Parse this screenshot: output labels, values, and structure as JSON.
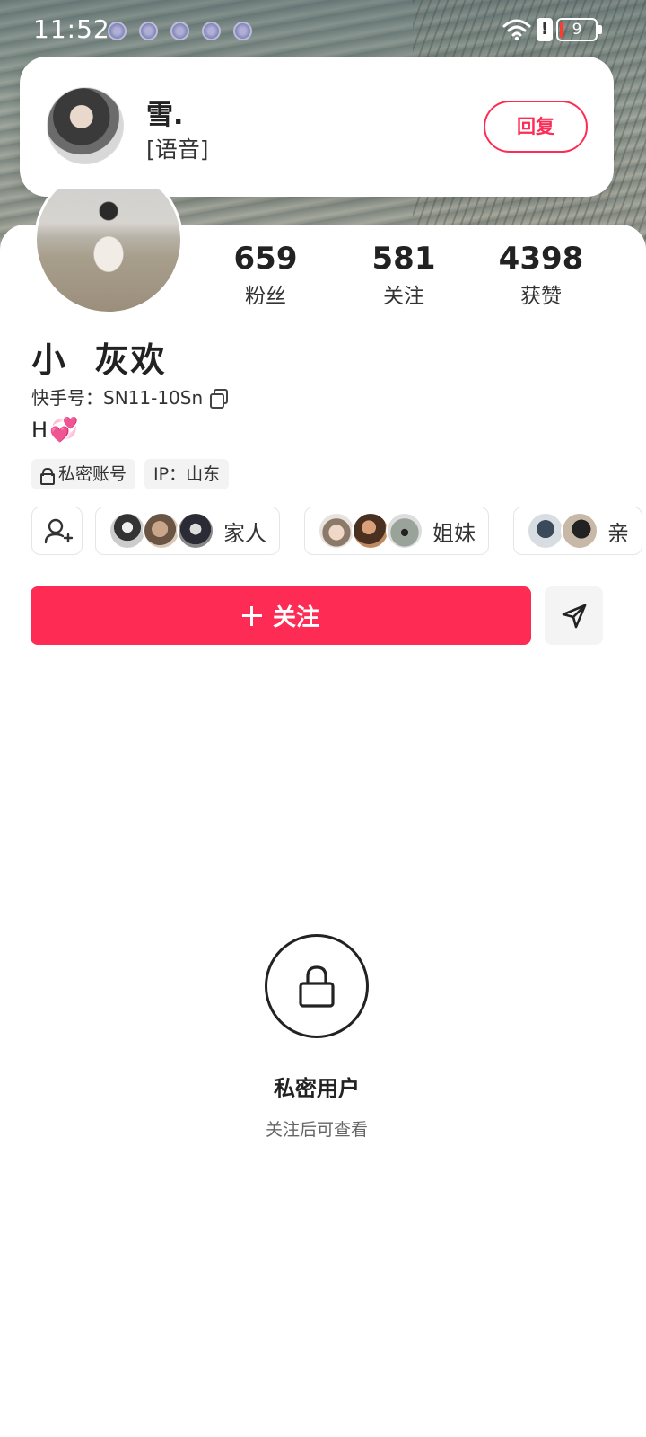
{
  "status_bar": {
    "time": "11:52",
    "battery": "9",
    "notification_icons": [
      "app-notification-icon",
      "app-notification-icon",
      "app-notification-icon",
      "app-notification-icon",
      "app-notification-icon"
    ],
    "indicators": [
      "wifi-icon",
      "alert-icon",
      "battery-icon"
    ],
    "alert_glyph": "!"
  },
  "notification": {
    "sender": "雪.",
    "message": "[语音]",
    "reply_label": "回复"
  },
  "profile": {
    "stats": [
      {
        "value": "659",
        "label": "粉丝"
      },
      {
        "value": "581",
        "label": "关注"
      },
      {
        "value": "4398",
        "label": "获赞"
      }
    ],
    "name": "小  灰欢",
    "kuaishou_id": "快手号：SN11-10Sn",
    "bio": "H",
    "bio_emoji": "💞",
    "tags": {
      "private": "私密账号",
      "ip": "IP：山东"
    },
    "groups": [
      {
        "label": "家人"
      },
      {
        "label": "姐妹"
      },
      {
        "label": "亲"
      }
    ],
    "follow_label": "关注"
  },
  "private_notice": {
    "title": "私密用户",
    "subtitle": "关注后可查看"
  },
  "colors": {
    "accent": "#fe2c55",
    "text": "#222222"
  }
}
